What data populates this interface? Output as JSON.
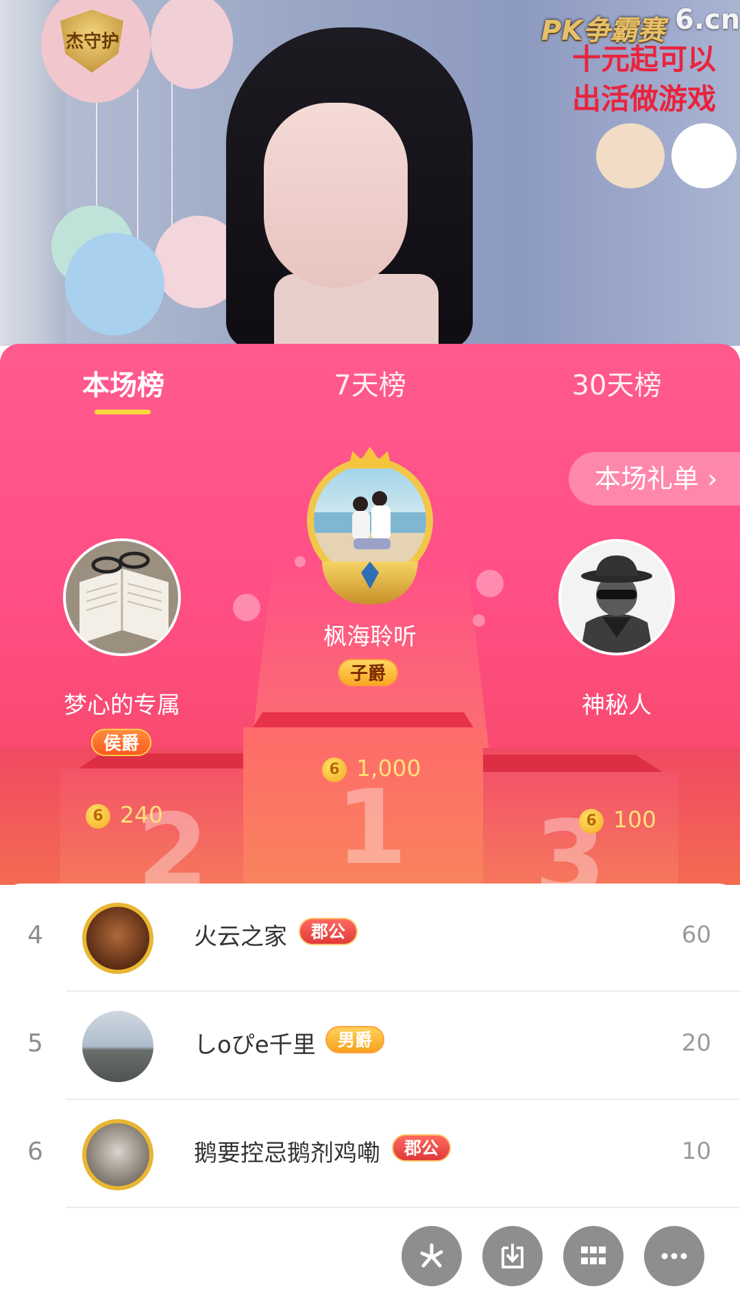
{
  "video": {
    "guard_badge": "杰守护",
    "pk_label": "PK争霸赛",
    "site_logo": "6.cn",
    "promo_line1": "十元起可以",
    "promo_line2": "出活做游戏"
  },
  "tabs": [
    {
      "label": "本场榜",
      "active": true
    },
    {
      "label": "7天榜",
      "active": false
    },
    {
      "label": "30天榜",
      "active": false
    }
  ],
  "gift_list_button": "本场礼单 ›",
  "podium": {
    "first": {
      "name": "枫海聆听",
      "title": "子爵",
      "score": "1,000",
      "rank": "1"
    },
    "second": {
      "name": "梦心的专属",
      "title": "侯爵",
      "score": "240",
      "rank": "2"
    },
    "third": {
      "name": "神秘人",
      "title": "",
      "score": "100",
      "rank": "3"
    }
  },
  "coin_symbol": "6",
  "list": [
    {
      "rank": "4",
      "name": "火云之家",
      "title": "郡公",
      "value": "60"
    },
    {
      "rank": "5",
      "name": "しoぴe千里",
      "title": "男爵",
      "value": "20"
    },
    {
      "rank": "6",
      "name": "鹅要控忌鹅剂鸡嘞",
      "title": "郡公",
      "value": "10"
    }
  ],
  "colors": {
    "panel_pink": "#ff5a8e",
    "tab_indicator": "#ffd83c",
    "score_gold": "#ffe27a"
  },
  "bottom_actions": [
    "share-icon",
    "download-icon",
    "grid-icon",
    "more-icon"
  ]
}
